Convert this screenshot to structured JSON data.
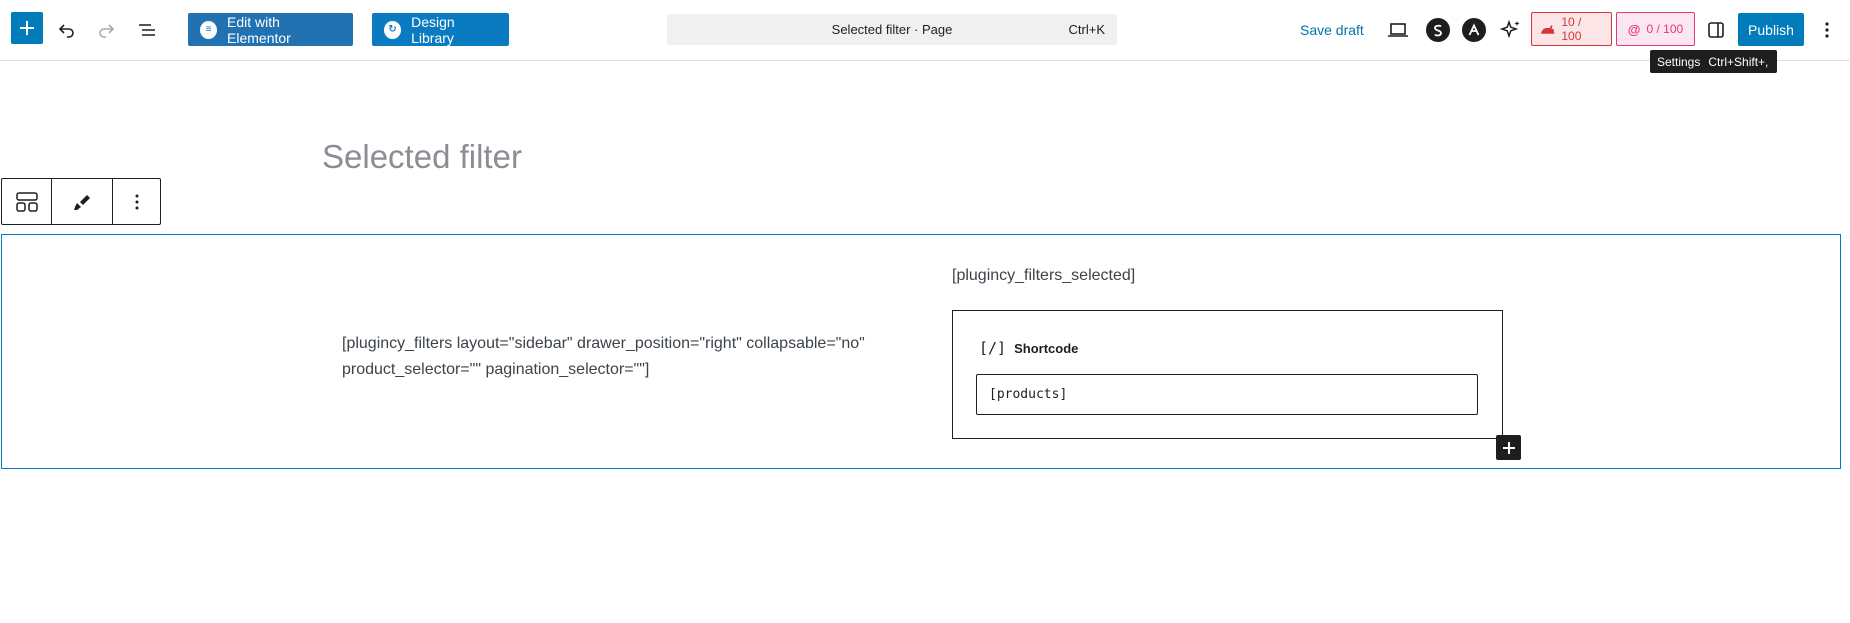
{
  "toolbar": {
    "edit_elementor_label": "Edit with Elementor",
    "design_library_label": "Design Library",
    "command_title": "Selected filter · Page",
    "command_shortcut": "Ctrl+K",
    "save_draft_label": "Save draft",
    "score_1": "10 / 100",
    "score_2": "0 / 100",
    "publish_label": "Publish",
    "tooltip_label": "Settings",
    "tooltip_shortcut": "Ctrl+Shift+,",
    "icons": {
      "add": "plus-icon",
      "undo": "undo-icon",
      "redo": "redo-icon",
      "outline": "list-view-icon",
      "view": "desktop-preview-icon",
      "seo_s": "s-logo-icon",
      "ast": "a-logo-icon",
      "ai": "sparkle-icon",
      "score1": "seo-score-icon",
      "score2": "readability-score-icon",
      "settings": "sidebar-toggle-icon",
      "more": "more-vertical-icon"
    },
    "colors": {
      "accent": "#007cba",
      "score_red": "#d63638",
      "score_pink": "#e2387e"
    }
  },
  "editor": {
    "page_title": "Selected filter",
    "left_column_text": "[plugincy_filters layout=\"sidebar\" drawer_position=\"right\" collapsable=\"no\" product_selector=\"\" pagination_selector=\"\"]",
    "right_column_text": "[plugincy_filters_selected]",
    "shortcode_block_label": "Shortcode",
    "shortcode_block_icon": "[/]",
    "shortcode_value": "[products]"
  }
}
